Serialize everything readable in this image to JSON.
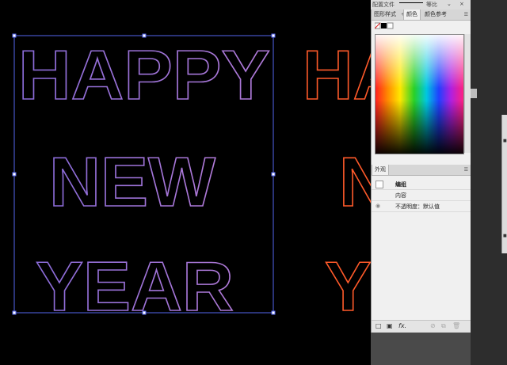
{
  "art": {
    "line1": "HAPPY",
    "line2": "NEW",
    "line3": "YEAR",
    "second_copy_visible": [
      "HA",
      "N",
      "Y"
    ],
    "colors": {
      "outline_purple": "#7b5fd0",
      "outline_orange": "#ff5a2a",
      "selection": "#5566ee"
    }
  },
  "topbar": {
    "label": "配置文件",
    "dropdown": "等比"
  },
  "panel": {
    "tabs": [
      "图形样式",
      "颜色",
      "颜色参考"
    ],
    "active_tab": "颜色",
    "appearance_tab": "外观",
    "rows": [
      "编组",
      "内容",
      "不透明度：默认值"
    ],
    "bottom_icons": [
      "□",
      "▣",
      "fx.",
      "⊘",
      "⧉",
      "🗑"
    ]
  },
  "icons": [
    "menu-icon",
    "stroke-swatch-icon",
    "eye-icon",
    "fx-icon"
  ]
}
